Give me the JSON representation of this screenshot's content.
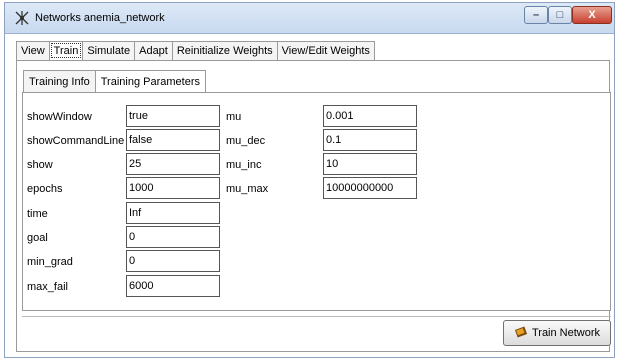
{
  "window": {
    "title": "Networks anemia_network",
    "controls": {
      "minimize": "–",
      "maximize": "□",
      "close": "X"
    }
  },
  "main_tabs": [
    "View",
    "Train",
    "Simulate",
    "Adapt",
    "Reinitialize Weights",
    "View/Edit Weights"
  ],
  "sub_tabs": [
    "Training Info",
    "Training Parameters"
  ],
  "params_left": [
    {
      "label": "showWindow",
      "value": "true"
    },
    {
      "label": "showCommandLine",
      "value": "false"
    },
    {
      "label": "show",
      "value": "25"
    },
    {
      "label": "epochs",
      "value": "1000"
    },
    {
      "label": "time",
      "value": "Inf"
    },
    {
      "label": "goal",
      "value": "0"
    },
    {
      "label": "min_grad",
      "value": "0"
    },
    {
      "label": "max_fail",
      "value": "6000"
    }
  ],
  "params_right": [
    {
      "label": "mu",
      "value": "0.001"
    },
    {
      "label": "mu_dec",
      "value": "0.1"
    },
    {
      "label": "mu_inc",
      "value": "10"
    },
    {
      "label": "mu_max",
      "value": "10000000000"
    }
  ],
  "train_button": {
    "label": "Train Network",
    "icon": "train-network-icon"
  },
  "colors": {
    "titlebar": "#dde9f7",
    "close_button": "#c84030"
  }
}
